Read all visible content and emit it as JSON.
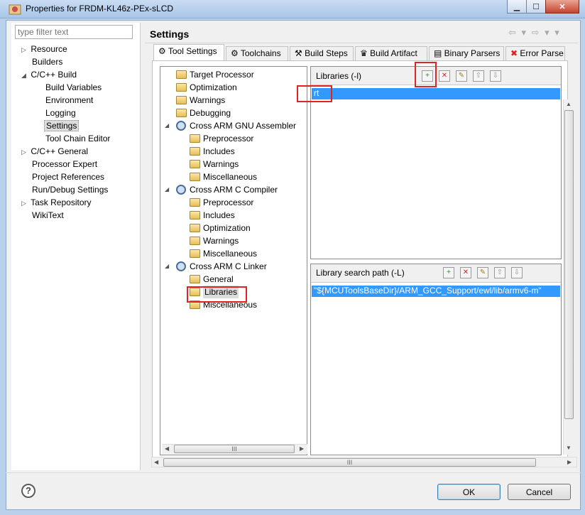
{
  "window": {
    "title": "Properties for FRDM-KL46z-PEx-sLCD",
    "minimize": "▁",
    "maximize": "☐",
    "close": "✕"
  },
  "filter": {
    "placeholder": "type filter text"
  },
  "sidebar": {
    "items": [
      {
        "label": "Resource",
        "expander": "▷"
      },
      {
        "label": "Builders"
      },
      {
        "label": "C/C++ Build",
        "expander": "◢"
      },
      {
        "label": "Build Variables"
      },
      {
        "label": "Environment"
      },
      {
        "label": "Logging"
      },
      {
        "label": "Settings"
      },
      {
        "label": "Tool Chain Editor"
      },
      {
        "label": "C/C++ General",
        "expander": "▷"
      },
      {
        "label": "Processor Expert"
      },
      {
        "label": "Project References"
      },
      {
        "label": "Run/Debug Settings"
      },
      {
        "label": "Task Repository",
        "expander": "▷"
      },
      {
        "label": "WikiText"
      }
    ]
  },
  "header": {
    "title": "Settings",
    "nav": "⇦ ▾ ⇨ ▾ ▾"
  },
  "tabs": [
    {
      "label": "Tool Settings"
    },
    {
      "label": "Toolchains"
    },
    {
      "label": "Build Steps"
    },
    {
      "label": "Build Artifact"
    },
    {
      "label": "Binary Parsers"
    },
    {
      "label": "Error Parse"
    }
  ],
  "tool_tree": {
    "items": [
      {
        "label": "Target Processor",
        "icon": "folder"
      },
      {
        "label": "Optimization",
        "icon": "folder"
      },
      {
        "label": "Warnings",
        "icon": "folder"
      },
      {
        "label": "Debugging",
        "icon": "folder"
      },
      {
        "label": "Cross ARM GNU Assembler",
        "icon": "gear",
        "expander": "◢"
      },
      {
        "label": "Preprocessor",
        "icon": "folder"
      },
      {
        "label": "Includes",
        "icon": "folder"
      },
      {
        "label": "Warnings",
        "icon": "folder"
      },
      {
        "label": "Miscellaneous",
        "icon": "folder"
      },
      {
        "label": "Cross ARM C Compiler",
        "icon": "gear",
        "expander": "◢"
      },
      {
        "label": "Preprocessor",
        "icon": "folder"
      },
      {
        "label": "Includes",
        "icon": "folder"
      },
      {
        "label": "Optimization",
        "icon": "folder"
      },
      {
        "label": "Warnings",
        "icon": "folder"
      },
      {
        "label": "Miscellaneous",
        "icon": "folder"
      },
      {
        "label": "Cross ARM C Linker",
        "icon": "gear",
        "expander": "◢"
      },
      {
        "label": "General",
        "icon": "folder"
      },
      {
        "label": "Libraries",
        "icon": "folder"
      },
      {
        "label": "Miscellaneous",
        "icon": "folder"
      }
    ],
    "scroll_thumb": "III"
  },
  "libraries": {
    "title": "Libraries (-l)",
    "items": [
      "rt"
    ]
  },
  "search_paths": {
    "title": "Library search path (-L)",
    "items": [
      "\"${MCUToolsBaseDir}/ARM_GCC_Support/ewl/lib/armv6-m\""
    ]
  },
  "outer_scroll_thumb": "III",
  "buttons": {
    "help": "?",
    "ok": "OK",
    "cancel": "Cancel"
  },
  "colors": {
    "selection": "#3399ff",
    "highlight_box": "#e02424"
  }
}
